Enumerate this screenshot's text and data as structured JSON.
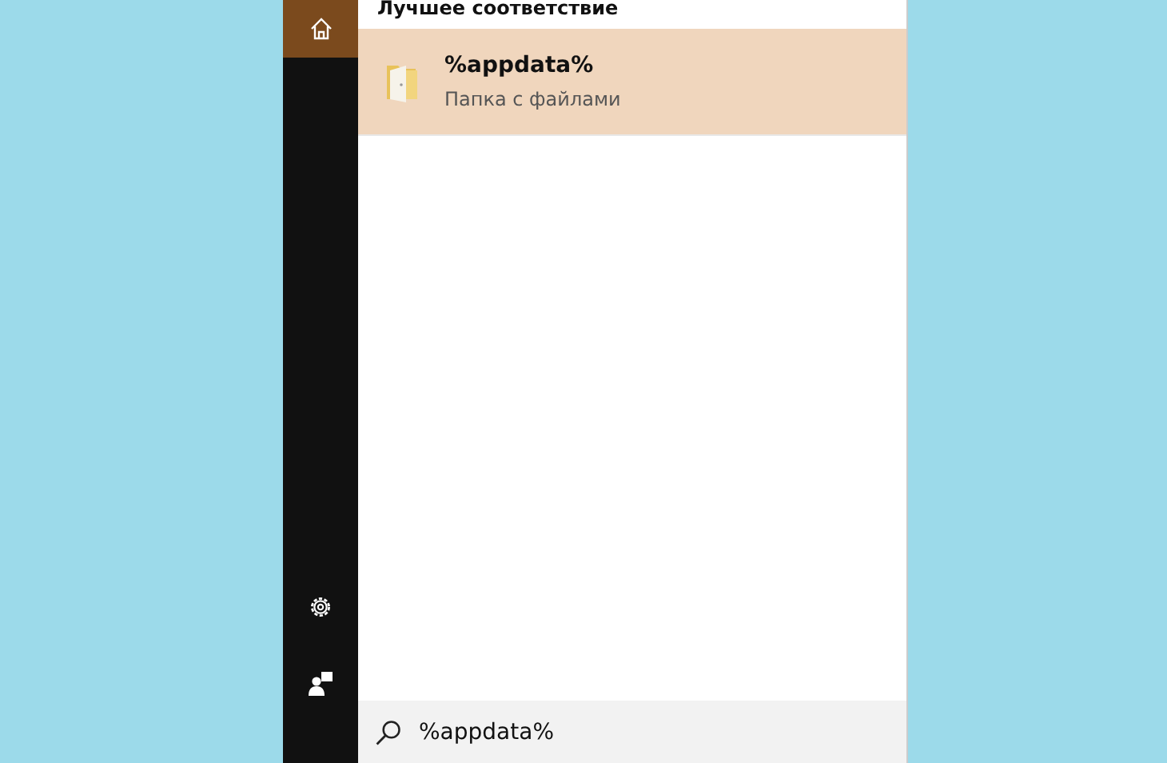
{
  "sidebar": {
    "items": [
      {
        "kind": "home",
        "selected": true
      },
      {
        "kind": "settings",
        "selected": false
      },
      {
        "kind": "feedback",
        "selected": false
      }
    ]
  },
  "best_match": {
    "heading": "Лучшее соответствие",
    "result": {
      "title": "%appdata%",
      "subtitle": "Папка с файлами",
      "selected": true
    }
  },
  "search": {
    "value": "%appdata%"
  }
}
